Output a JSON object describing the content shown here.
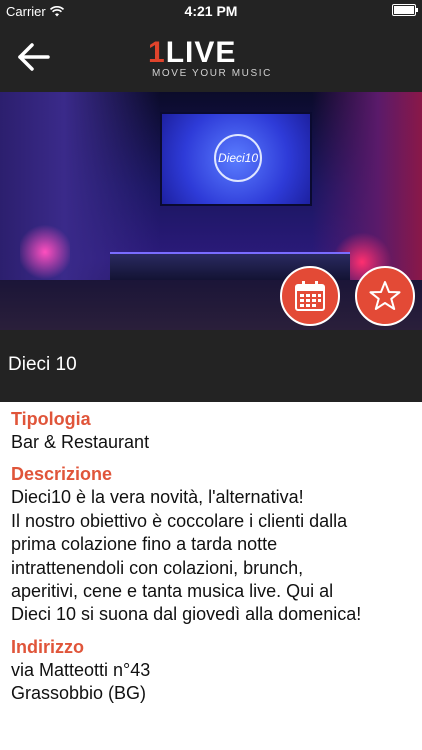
{
  "status_bar": {
    "carrier": "Carrier",
    "time": "4:21 PM",
    "battery_level": 1.0
  },
  "nav": {
    "logo_main_one": "1",
    "logo_main_rest": "LIVE",
    "logo_tagline": "MOVE YOUR MUSIC",
    "back_icon": "arrow-left-icon"
  },
  "hero": {
    "screen_logo_text": "Dieci10"
  },
  "actions": {
    "calendar_icon": "calendar-icon",
    "star_icon": "star-icon",
    "accent_color": "#e34a36"
  },
  "venue": {
    "title": "Dieci 10"
  },
  "details": {
    "tipologia_label": "Tipologia",
    "tipologia_value": "Bar & Restaurant",
    "descrizione_label": "Descrizione",
    "descrizione_lines": [
      "Dieci10 è la vera novità, l'alternativa!",
      "Il nostro obiettivo è coccolare i clienti dalla",
      "prima colazione fino a tarda notte",
      "intrattenendoli con colazioni, brunch,",
      "aperitivi, cene e tanta musica live. Qui al",
      "Dieci 10 si suona dal giovedì alla domenica!"
    ],
    "indirizzo_label": "Indirizzo",
    "indirizzo_line1": "via Matteotti n°43",
    "indirizzo_line2": "Grassobbio (BG)"
  }
}
